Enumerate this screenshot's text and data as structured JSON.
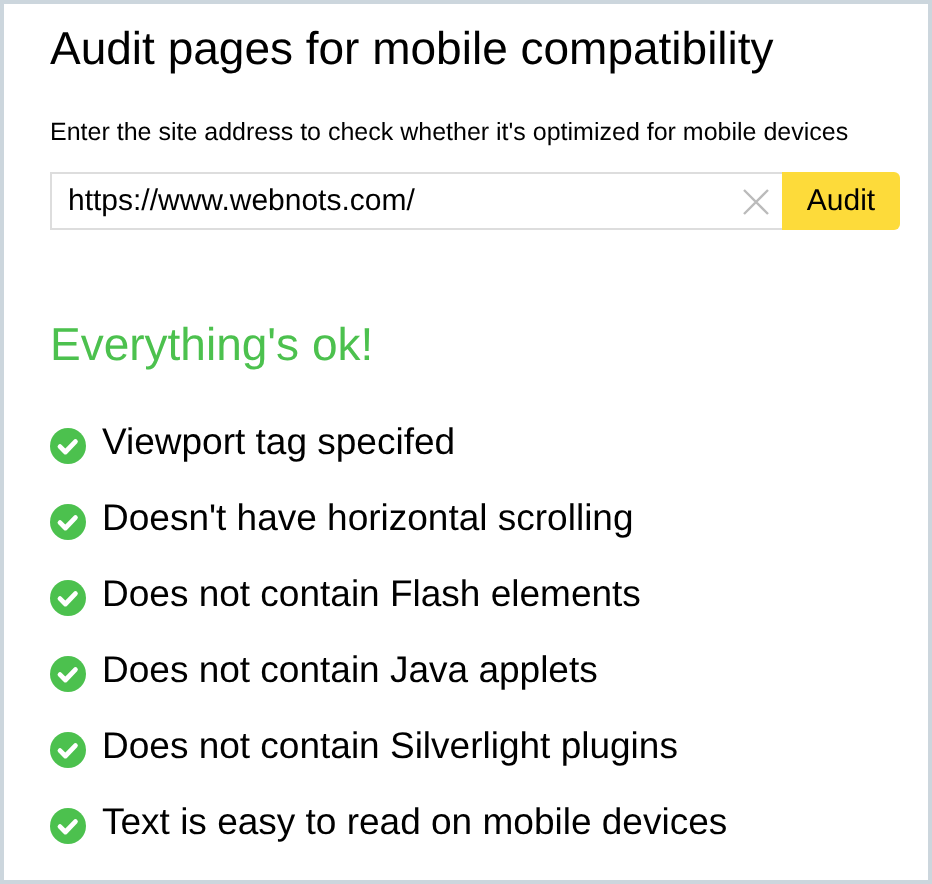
{
  "title": "Audit pages for mobile compatibility",
  "instructions": "Enter the site address to check whether it's optimized for mobile devices",
  "url_field": {
    "value": "https://www.webnots.com/"
  },
  "audit_button": "Audit",
  "result": "Everything's ok!",
  "checks": [
    {
      "label": "Viewport tag specifed",
      "passed": true
    },
    {
      "label": "Doesn't have horizontal scrolling",
      "passed": true
    },
    {
      "label": "Does not contain Flash elements",
      "passed": true
    },
    {
      "label": "Does not contain Java applets",
      "passed": true
    },
    {
      "label": "Does not contain Silverlight plugins",
      "passed": true
    },
    {
      "label": "Text is easy to read on mobile devices",
      "passed": true
    }
  ]
}
